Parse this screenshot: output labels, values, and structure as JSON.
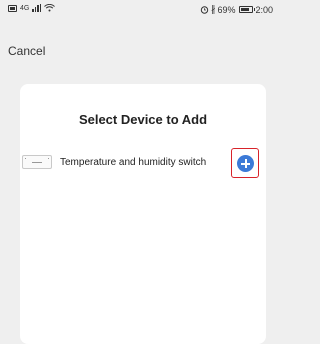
{
  "status_bar": {
    "network_label": "4G",
    "battery_percent": "69%",
    "time": "2:00"
  },
  "header": {
    "cancel_label": "Cancel"
  },
  "card": {
    "title": "Select Device to Add",
    "devices": [
      {
        "name": "Temperature and humidity switch",
        "add_icon": "plus-circle-icon"
      }
    ]
  },
  "colors": {
    "background": "#efefef",
    "card": "#ffffff",
    "accent": "#3c7ad7",
    "highlight_border": "#d8232a"
  }
}
